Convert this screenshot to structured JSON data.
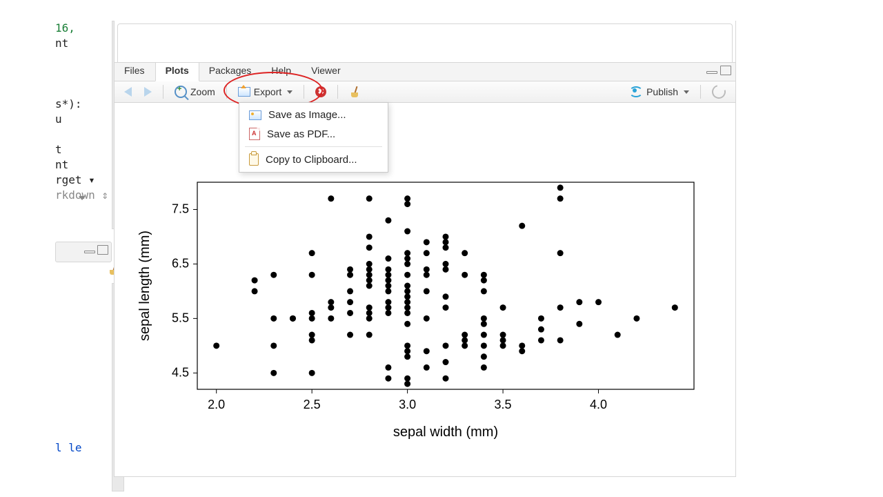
{
  "editor": {
    "lines": [
      {
        "cls": "c-num",
        "t": "16,"
      },
      {
        "cls": "c-id",
        "t": "nt"
      },
      {
        "cls": "",
        "t": ""
      },
      {
        "cls": "",
        "t": ""
      },
      {
        "cls": "",
        "t": ""
      },
      {
        "cls": "c-id",
        "t": "s*):"
      },
      {
        "cls": "c-id",
        "t": "u"
      },
      {
        "cls": "",
        "t": ""
      },
      {
        "cls": "c-id",
        "t": "t"
      },
      {
        "cls": "c-id",
        "t": "nt"
      },
      {
        "cls": "c-id",
        "t": "rget ▾"
      },
      {
        "cls": "c-op",
        "t": "rkdown ⇕"
      }
    ],
    "bottom_line": "l le"
  },
  "tabs": {
    "files": "Files",
    "plots": "Plots",
    "packages": "Packages",
    "help": "Help",
    "viewer": "Viewer",
    "active": "plots"
  },
  "toolbar": {
    "zoom": "Zoom",
    "export": "Export",
    "publish": "Publish"
  },
  "export_menu": {
    "save_image": "Save as Image...",
    "save_pdf": "Save as PDF...",
    "copy_clipboard": "Copy to Clipboard..."
  },
  "chart_data": {
    "type": "scatter",
    "xlabel": "sepal width (mm)",
    "ylabel": "sepal length (mm)",
    "xlim": [
      1.9,
      4.5
    ],
    "ylim": [
      4.2,
      8.0
    ],
    "xticks": [
      2.0,
      2.5,
      3.0,
      3.5,
      4.0
    ],
    "yticks": [
      4.5,
      5.5,
      6.5,
      7.5
    ],
    "points": [
      [
        2.0,
        5.0
      ],
      [
        2.2,
        6.0
      ],
      [
        2.2,
        6.2
      ],
      [
        2.3,
        4.5
      ],
      [
        2.3,
        5.0
      ],
      [
        2.3,
        5.5
      ],
      [
        2.3,
        6.3
      ],
      [
        2.4,
        5.5
      ],
      [
        2.4,
        5.5
      ],
      [
        2.5,
        4.5
      ],
      [
        2.5,
        5.1
      ],
      [
        2.5,
        5.2
      ],
      [
        2.5,
        5.5
      ],
      [
        2.5,
        5.6
      ],
      [
        2.5,
        6.3
      ],
      [
        2.5,
        6.7
      ],
      [
        2.6,
        5.5
      ],
      [
        2.6,
        5.7
      ],
      [
        2.6,
        5.8
      ],
      [
        2.6,
        7.7
      ],
      [
        2.7,
        5.2
      ],
      [
        2.7,
        5.6
      ],
      [
        2.7,
        5.8
      ],
      [
        2.7,
        6.0
      ],
      [
        2.7,
        6.3
      ],
      [
        2.7,
        6.4
      ],
      [
        2.8,
        5.2
      ],
      [
        2.8,
        5.5
      ],
      [
        2.8,
        5.6
      ],
      [
        2.8,
        5.7
      ],
      [
        2.8,
        6.1
      ],
      [
        2.8,
        6.2
      ],
      [
        2.8,
        6.3
      ],
      [
        2.8,
        6.4
      ],
      [
        2.8,
        6.5
      ],
      [
        2.8,
        6.8
      ],
      [
        2.8,
        7.0
      ],
      [
        2.8,
        7.7
      ],
      [
        2.9,
        4.4
      ],
      [
        2.9,
        4.6
      ],
      [
        2.9,
        5.6
      ],
      [
        2.9,
        5.7
      ],
      [
        2.9,
        5.8
      ],
      [
        2.9,
        6.0
      ],
      [
        2.9,
        6.1
      ],
      [
        2.9,
        6.2
      ],
      [
        2.9,
        6.3
      ],
      [
        2.9,
        6.4
      ],
      [
        2.9,
        6.6
      ],
      [
        2.9,
        7.3
      ],
      [
        3.0,
        4.3
      ],
      [
        3.0,
        4.4
      ],
      [
        3.0,
        4.8
      ],
      [
        3.0,
        4.9
      ],
      [
        3.0,
        5.0
      ],
      [
        3.0,
        5.4
      ],
      [
        3.0,
        5.6
      ],
      [
        3.0,
        5.7
      ],
      [
        3.0,
        5.8
      ],
      [
        3.0,
        5.9
      ],
      [
        3.0,
        6.0
      ],
      [
        3.0,
        6.1
      ],
      [
        3.0,
        6.3
      ],
      [
        3.0,
        6.5
      ],
      [
        3.0,
        6.6
      ],
      [
        3.0,
        6.7
      ],
      [
        3.0,
        7.1
      ],
      [
        3.0,
        7.6
      ],
      [
        3.0,
        7.7
      ],
      [
        3.1,
        4.6
      ],
      [
        3.1,
        4.9
      ],
      [
        3.1,
        5.5
      ],
      [
        3.1,
        6.0
      ],
      [
        3.1,
        6.3
      ],
      [
        3.1,
        6.4
      ],
      [
        3.1,
        6.7
      ],
      [
        3.1,
        6.9
      ],
      [
        3.2,
        4.4
      ],
      [
        3.2,
        4.7
      ],
      [
        3.2,
        5.0
      ],
      [
        3.2,
        5.7
      ],
      [
        3.2,
        5.9
      ],
      [
        3.2,
        6.4
      ],
      [
        3.2,
        6.5
      ],
      [
        3.2,
        6.8
      ],
      [
        3.2,
        6.9
      ],
      [
        3.2,
        7.0
      ],
      [
        3.3,
        5.0
      ],
      [
        3.3,
        5.1
      ],
      [
        3.3,
        5.2
      ],
      [
        3.3,
        6.3
      ],
      [
        3.3,
        6.7
      ],
      [
        3.4,
        4.6
      ],
      [
        3.4,
        4.8
      ],
      [
        3.4,
        5.0
      ],
      [
        3.4,
        5.2
      ],
      [
        3.4,
        5.4
      ],
      [
        3.4,
        5.5
      ],
      [
        3.4,
        6.0
      ],
      [
        3.4,
        6.2
      ],
      [
        3.4,
        6.3
      ],
      [
        3.5,
        5.0
      ],
      [
        3.5,
        5.1
      ],
      [
        3.5,
        5.2
      ],
      [
        3.5,
        5.7
      ],
      [
        3.6,
        4.9
      ],
      [
        3.6,
        5.0
      ],
      [
        3.6,
        7.2
      ],
      [
        3.7,
        5.1
      ],
      [
        3.7,
        5.3
      ],
      [
        3.7,
        5.5
      ],
      [
        3.8,
        5.1
      ],
      [
        3.8,
        5.7
      ],
      [
        3.8,
        6.7
      ],
      [
        3.8,
        7.7
      ],
      [
        3.8,
        7.9
      ],
      [
        3.9,
        5.4
      ],
      [
        3.9,
        5.8
      ],
      [
        4.0,
        5.8
      ],
      [
        4.1,
        5.2
      ],
      [
        4.2,
        5.5
      ],
      [
        4.4,
        5.7
      ]
    ]
  }
}
